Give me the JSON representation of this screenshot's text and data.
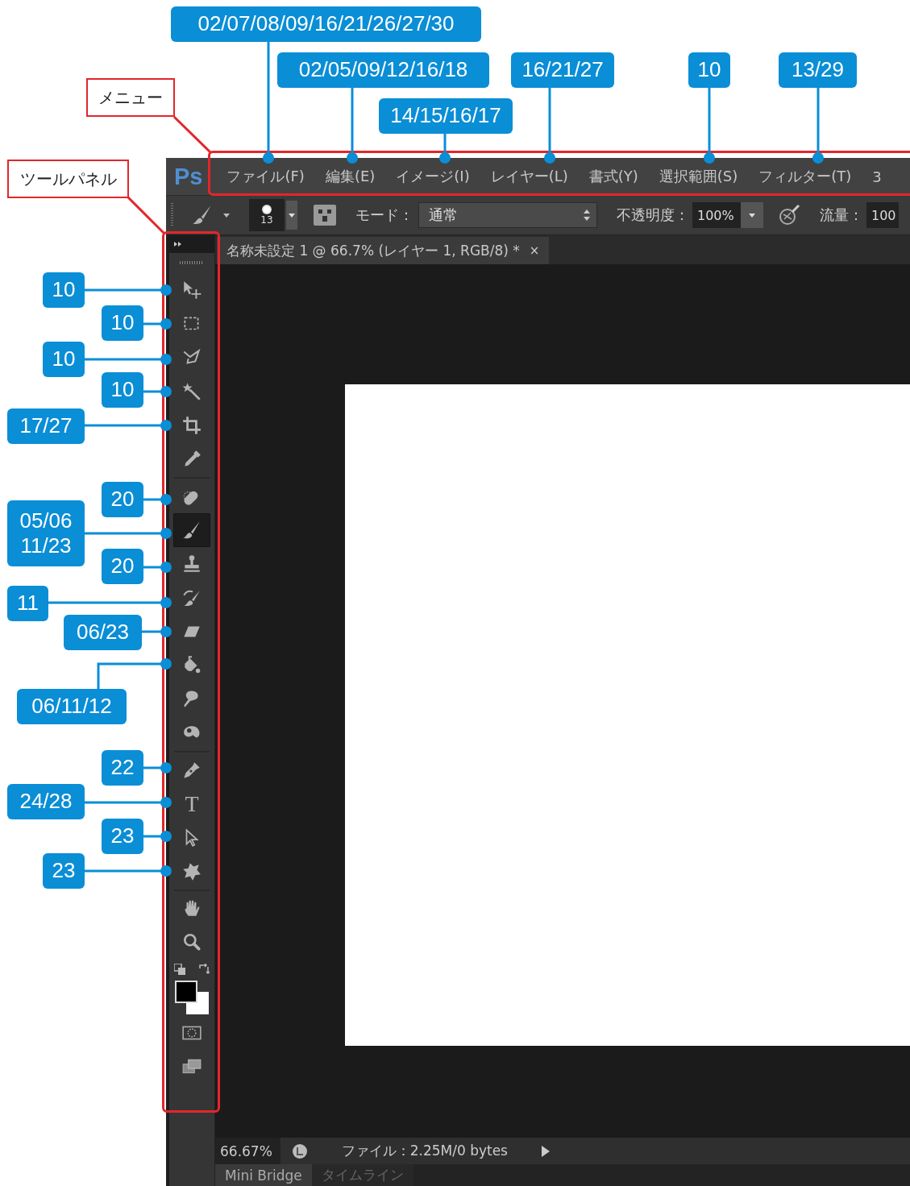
{
  "callouts": [
    {
      "text": "02/07/08/09/16/21/26/27/30"
    },
    {
      "text": "02/05/09/12/16/18"
    },
    {
      "text": "14/15/16/17"
    },
    {
      "text": "16/21/27"
    },
    {
      "text": "10"
    },
    {
      "text": "13/29"
    },
    {
      "text": "10"
    },
    {
      "text": "10"
    },
    {
      "text": "10"
    },
    {
      "text": "10"
    },
    {
      "text": "17/27"
    },
    {
      "text": "20"
    },
    {
      "text": "05/06 11/23"
    },
    {
      "text": "20"
    },
    {
      "text": "11"
    },
    {
      "text": "06/23"
    },
    {
      "text": "06/11/12"
    },
    {
      "text": "22"
    },
    {
      "text": "24/28"
    },
    {
      "text": "23"
    },
    {
      "text": "23"
    }
  ],
  "labels": [
    {
      "text": "メニュー"
    },
    {
      "text": "ツールパネル"
    }
  ],
  "logo": "Ps",
  "menu": [
    {
      "label": "ファイル(F)"
    },
    {
      "label": "編集(E)"
    },
    {
      "label": "イメージ(I)"
    },
    {
      "label": "レイヤー(L)"
    },
    {
      "label": "書式(Y)"
    },
    {
      "label": "選択範囲(S)"
    },
    {
      "label": "フィルター(T)"
    },
    {
      "label": "3"
    }
  ],
  "options_bar": {
    "brush_size": "13",
    "mode_label": "モード：",
    "mode_value": "通常",
    "opacity_label": "不透明度：",
    "opacity_value": "100%",
    "flow_label": "流量：",
    "flow_value": "100"
  },
  "document_tab": {
    "title": "名称未設定 1 @ 66.7% (レイヤー 1, RGB/8) *",
    "close": "×"
  },
  "tools": [
    {
      "kind": "move",
      "selected": false
    },
    {
      "kind": "marquee",
      "selected": false
    },
    {
      "kind": "lasso",
      "selected": false
    },
    {
      "kind": "wand",
      "selected": false
    },
    {
      "kind": "crop",
      "selected": false
    },
    {
      "kind": "eyedropper",
      "selected": false
    },
    {
      "kind": "healing",
      "selected": false
    },
    {
      "kind": "brush",
      "selected": true
    },
    {
      "kind": "stamp",
      "selected": false
    },
    {
      "kind": "history",
      "selected": false
    },
    {
      "kind": "eraser",
      "selected": false
    },
    {
      "kind": "bucket",
      "selected": false
    },
    {
      "kind": "smudge",
      "selected": false
    },
    {
      "kind": "sponge",
      "selected": false
    },
    {
      "kind": "pen",
      "selected": false
    },
    {
      "kind": "type",
      "selected": false,
      "glyph": "T"
    },
    {
      "kind": "path",
      "selected": false
    },
    {
      "kind": "shape",
      "selected": false
    },
    {
      "kind": "hand",
      "selected": false
    },
    {
      "kind": "zoom",
      "selected": false
    }
  ],
  "status_bar": {
    "zoom": "66.67%",
    "info": "ファイル：2.25M/0 bytes"
  },
  "panel_tabs": [
    {
      "label": "Mini Bridge",
      "selected": true
    },
    {
      "label": "タイムライン",
      "selected": false
    }
  ]
}
